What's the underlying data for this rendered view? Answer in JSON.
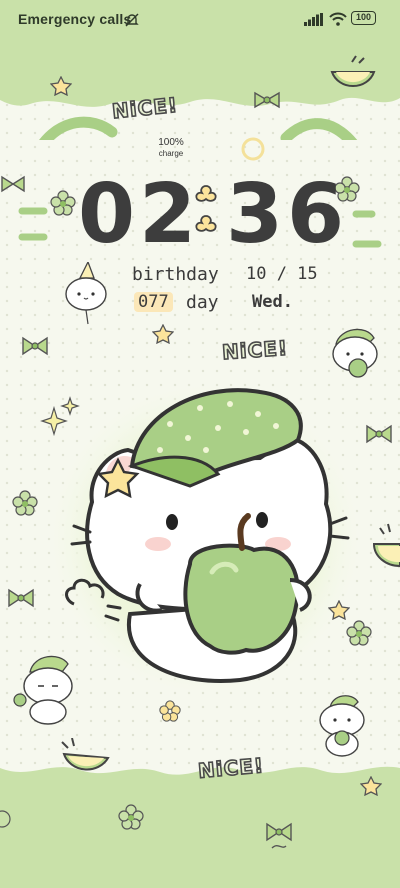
{
  "status_bar": {
    "carrier_text": "Emergency calls",
    "battery_level": "100",
    "icons": [
      "do-not-disturb-icon",
      "signal-icon",
      "wifi-icon",
      "battery-icon"
    ]
  },
  "lockscreen": {
    "charge": {
      "percent": "100%",
      "label": "charge"
    },
    "clock": {
      "hours": "02",
      "minutes": "36"
    },
    "info": {
      "birthday_label": "birthday",
      "date": "10 / 15",
      "day_count": "077",
      "day_label": "day",
      "weekday": "Wed."
    },
    "stickers": {
      "nice_text": "NiCE!"
    }
  },
  "colors": {
    "background": "#f6f8ee",
    "accent_green": "#a9cf86",
    "dark_green": "#6f9a4f",
    "text_dark": "#3d3d3d",
    "highlight": "#fbe7b8"
  }
}
